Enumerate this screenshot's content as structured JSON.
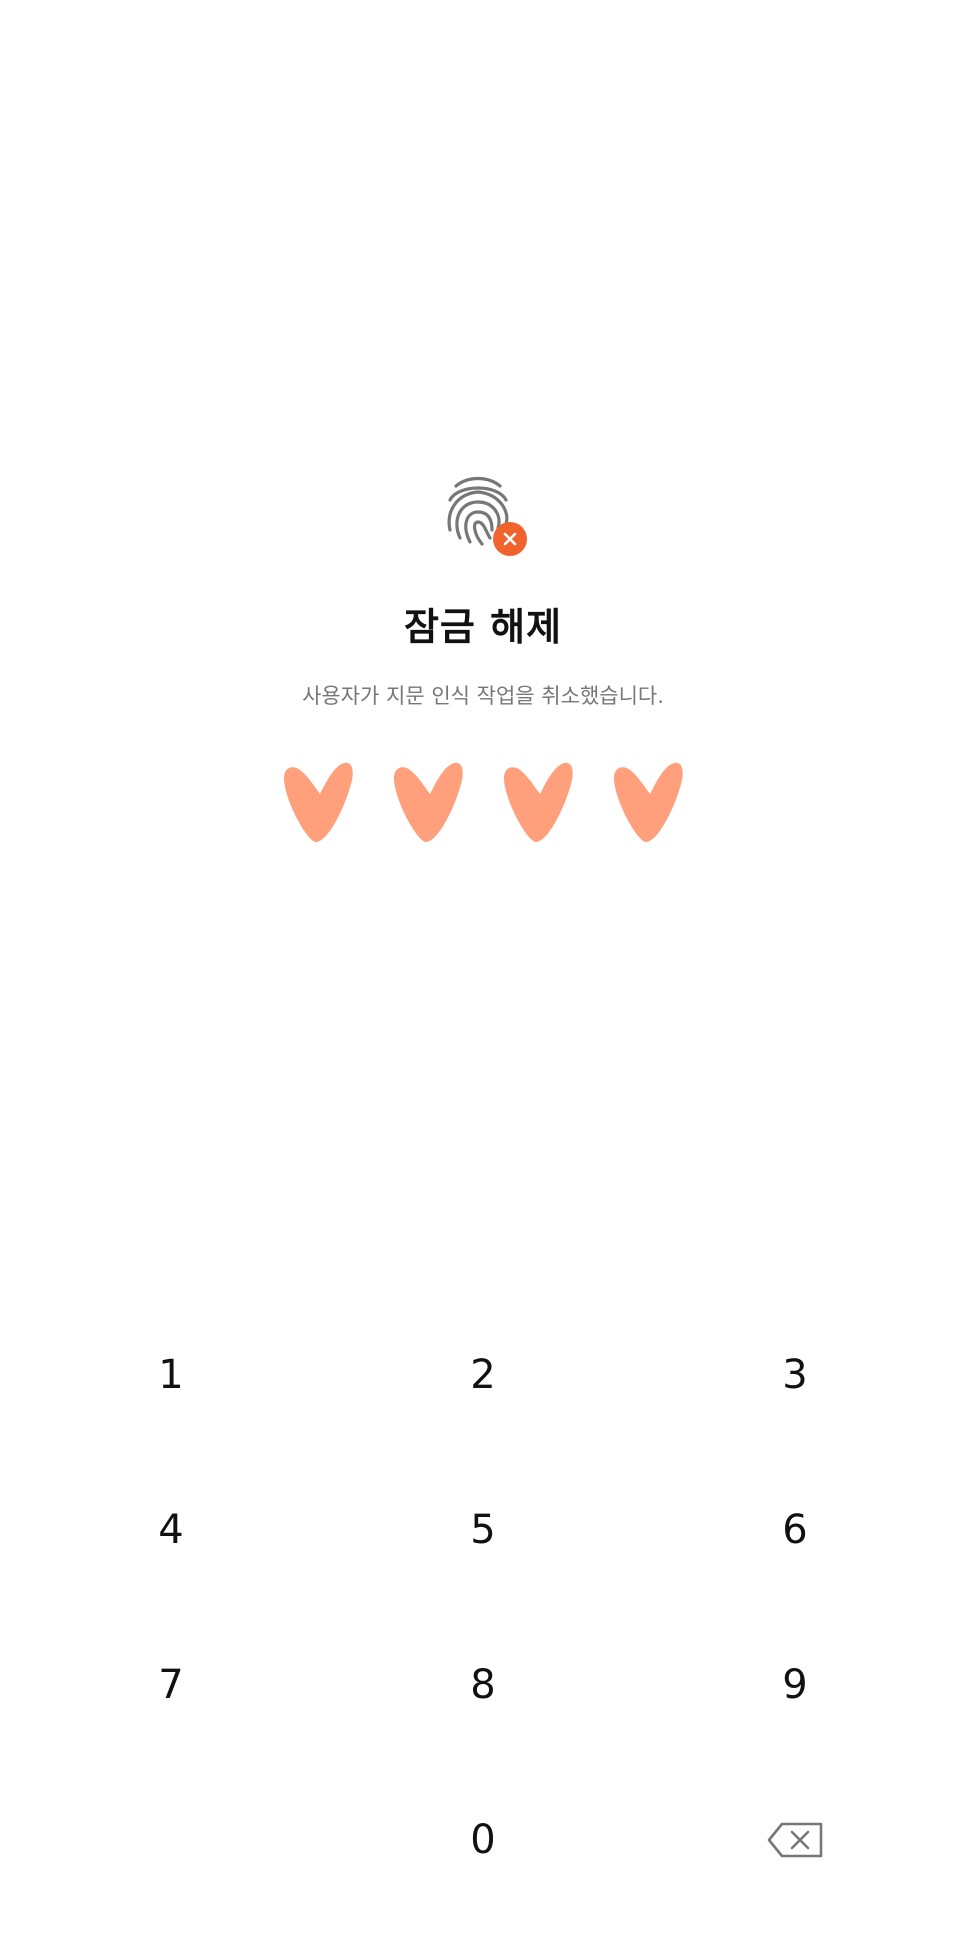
{
  "lock": {
    "title": "잠금 해제",
    "message": "사용자가 지문 인식 작업을 취소했습니다.",
    "pin_length": 4,
    "pin_entered": 4
  },
  "icons": {
    "fingerprint": "fingerprint-icon",
    "error": "close-icon",
    "backspace": "backspace-icon"
  },
  "colors": {
    "accent": "#f0632c",
    "pin_dot": "#ff9f7c",
    "icon_gray": "#777777",
    "text": "#111111"
  },
  "keypad": {
    "keys": [
      "1",
      "2",
      "3",
      "4",
      "5",
      "6",
      "7",
      "8",
      "9",
      "0"
    ]
  }
}
